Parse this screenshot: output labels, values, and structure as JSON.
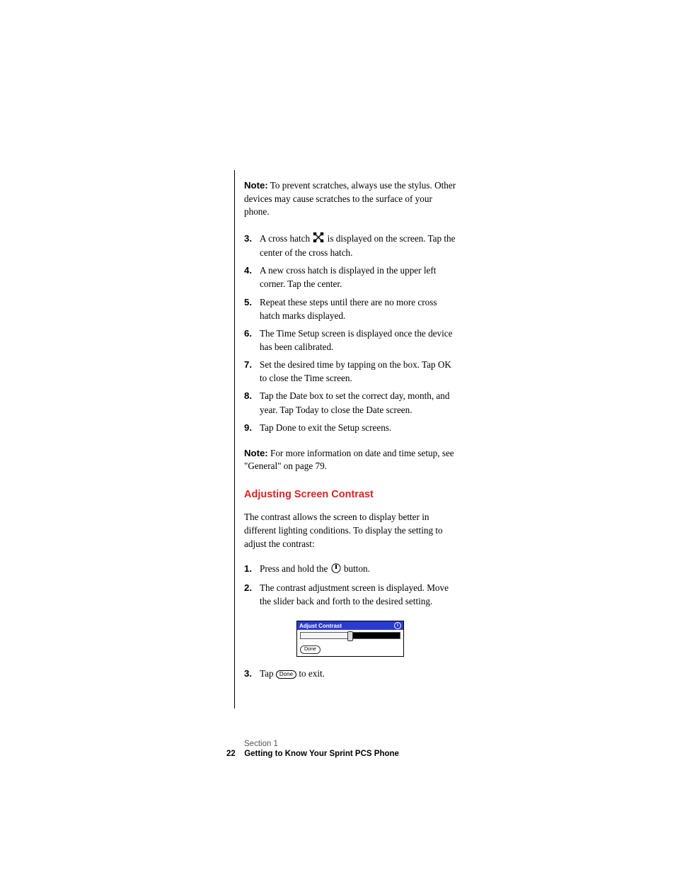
{
  "note1": {
    "label": "Note:",
    "text": "To prevent scratches, always use the stylus. Other devices may cause scratches to the surface of your phone."
  },
  "stepsA": [
    {
      "num": "3.",
      "before": "A cross hatch ",
      "after": " is displayed on the screen. Tap the center of the cross hatch."
    },
    {
      "num": "4.",
      "text": "A new cross hatch is displayed in the upper left corner. Tap the center."
    },
    {
      "num": "5.",
      "text": "Repeat these steps until there are no more cross hatch marks displayed."
    },
    {
      "num": "6.",
      "text": "The Time Setup screen is displayed once the device has been calibrated."
    },
    {
      "num": "7.",
      "text": "Set the desired time by tapping on the box. Tap OK to close the Time screen."
    },
    {
      "num": "8.",
      "text": "Tap the Date box to set the correct day, month, and year. Tap Today to close the Date screen."
    },
    {
      "num": "9.",
      "text": "Tap Done to exit the Setup screens."
    }
  ],
  "note2": {
    "label": "Note:",
    "text": "For more information on date and time setup, see \"General\" on page 79."
  },
  "heading": "Adjusting Screen Contrast",
  "intro": "The contrast allows the screen to display better in different lighting conditions. To display the setting to adjust the contrast:",
  "stepsB": [
    {
      "num": "1.",
      "before": "Press and hold the ",
      "after": " button."
    },
    {
      "num": "2.",
      "text": "The contrast adjustment screen is displayed. Move the slider back and forth to the desired setting."
    }
  ],
  "widget": {
    "title": "Adjust Contrast",
    "done": "Done"
  },
  "step3": {
    "num": "3.",
    "before": "Tap ",
    "pill": "Done",
    "after": " to exit."
  },
  "footer": {
    "section": "Section 1",
    "page": "22",
    "title": "Getting to Know Your Sprint PCS Phone"
  }
}
